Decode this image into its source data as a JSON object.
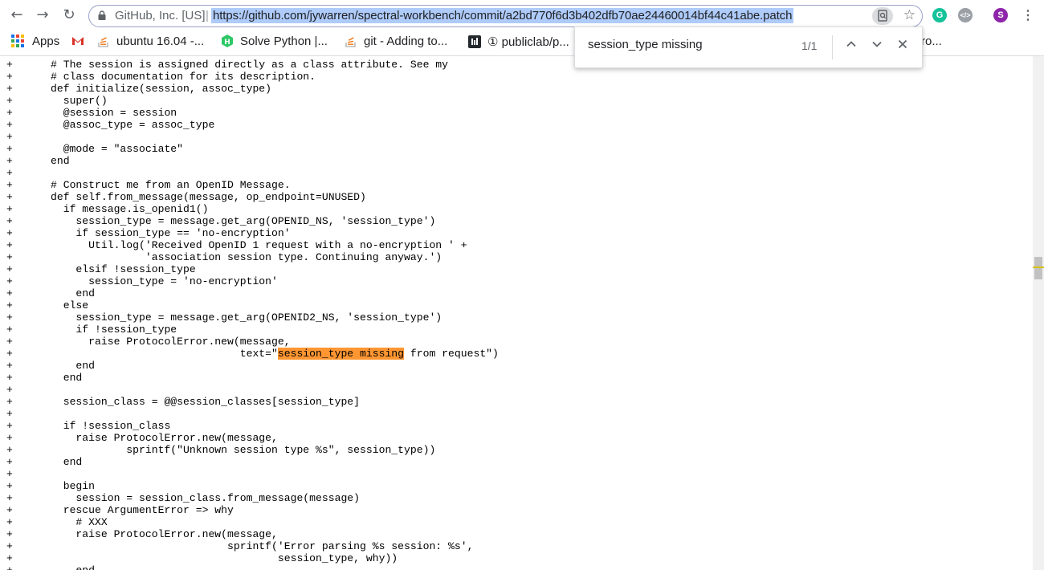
{
  "browser": {
    "origin": "GitHub, Inc. [US]",
    "url": "https://github.com/jywarren/spectral-workbench/commit/a2bd770f6d3b402dfb70ae24460014bf44c41abe.patch",
    "profile_initial": "S",
    "colors": {
      "url_selection": "#aecbfa",
      "grammarly": "#15c39a",
      "profile": "#8e24aa"
    }
  },
  "bookmarks": [
    {
      "label": "Apps",
      "icon": "apps-grid-icon"
    },
    {
      "label": "",
      "icon": "gmail-icon"
    },
    {
      "label": "ubuntu 16.04 -...",
      "icon": "stackoverflow-icon"
    },
    {
      "label": "Solve Python |...",
      "icon": "hackerrank-icon"
    },
    {
      "label": "git - Adding to...",
      "icon": "stackoverflow-icon"
    },
    {
      "label": "① publiclab/p...",
      "icon": "github-icon"
    },
    {
      "label": "ro...",
      "icon": ""
    }
  ],
  "find": {
    "query": "session_type missing",
    "count": "1/1",
    "highlight_color": "#ff9632"
  },
  "code": {
    "lines_before_match": [
      "+      # The session is assigned directly as a class attribute. See my",
      "+      # class documentation for its description.",
      "+      def initialize(session, assoc_type)",
      "+        super()",
      "+        @session = session",
      "+        @assoc_type = assoc_type",
      "+",
      "+        @mode = \"associate\"",
      "+      end",
      "+",
      "+      # Construct me from an OpenID Message.",
      "+      def self.from_message(message, op_endpoint=UNUSED)",
      "+        if message.is_openid1()",
      "+          session_type = message.get_arg(OPENID_NS, 'session_type')",
      "+          if session_type == 'no-encryption'",
      "+            Util.log('Received OpenID 1 request with a no-encryption ' +",
      "+                     'association session type. Continuing anyway.')",
      "+          elsif !session_type",
      "+            session_type = 'no-encryption'",
      "+          end",
      "+        else",
      "+          session_type = message.get_arg(OPENID2_NS, 'session_type')",
      "+          if !session_type",
      "+            raise ProtocolError.new(message,"
    ],
    "match_line_prefix": "+                                    text=\"",
    "match_text": "session_type missing",
    "match_line_suffix": " from request\")",
    "lines_after_match": [
      "+          end",
      "+        end",
      "+",
      "+        session_class = @@session_classes[session_type]",
      "+",
      "+        if !session_class",
      "+          raise ProtocolError.new(message,",
      "+                  sprintf(\"Unknown session type %s\", session_type))",
      "+        end",
      "+",
      "+        begin",
      "+          session = session_class.from_message(message)",
      "+        rescue ArgumentError => why",
      "+          # XXX",
      "+          raise ProtocolError.new(message,",
      "+                                  sprintf('Error parsing %s session: %s',",
      "+                                          session_type, why))",
      "+          end"
    ]
  }
}
